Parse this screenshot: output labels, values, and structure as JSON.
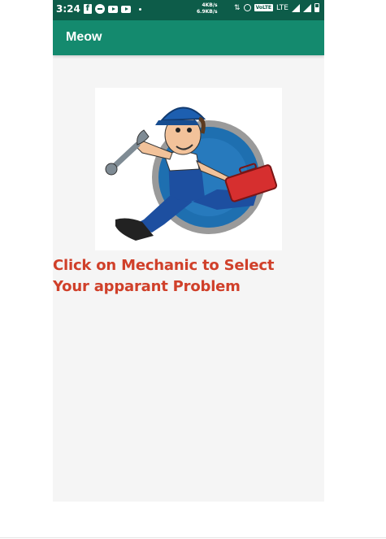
{
  "status_bar": {
    "time": "3:24",
    "speed_up": "4KB/s",
    "speed_down": "6.9KB/s",
    "volte": "VoLTE",
    "network": "LTE",
    "icons": [
      "facebook-icon",
      "circle-icon",
      "youtube-icon",
      "youtube-icon",
      "dot-icon",
      "arrows-icon",
      "alarm-icon",
      "signal-icon",
      "battery-icon"
    ]
  },
  "app_bar": {
    "title": "Meow"
  },
  "main": {
    "image": "mechanic-illustration",
    "prompt_line1": "Click on Mechanic to Select",
    "prompt_line2": "Your apparant Problem"
  },
  "colors": {
    "status_bar": "#0d5c49",
    "app_bar": "#148a6e",
    "prompt_text": "#d0402a",
    "background": "#f5f5f5"
  }
}
